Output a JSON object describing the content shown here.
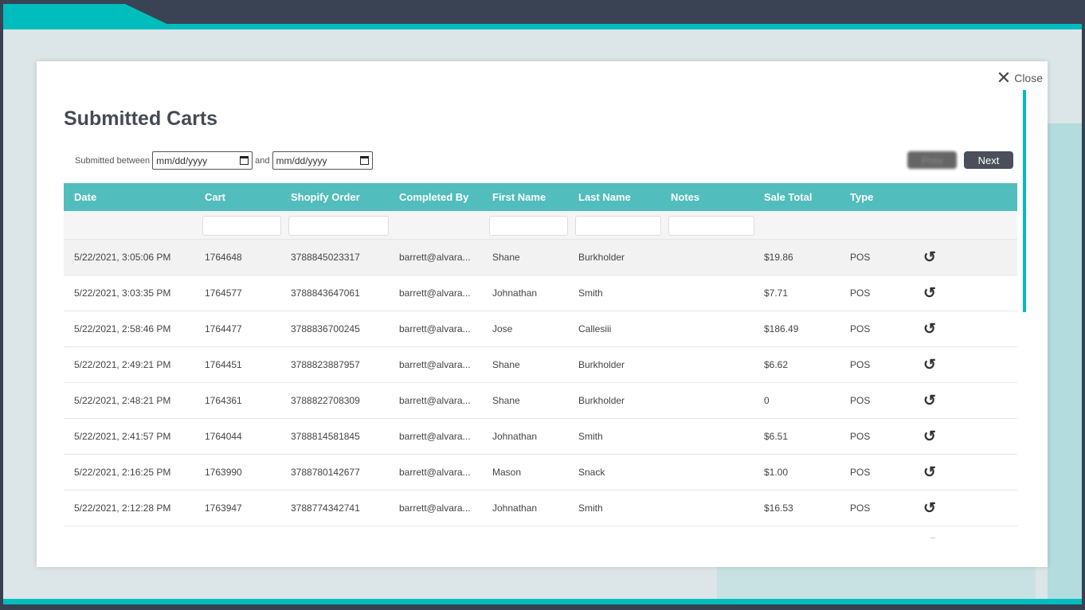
{
  "close_label": "Close",
  "title": "Submitted Carts",
  "filter": {
    "label": "Submitted between",
    "and": "and",
    "from_placeholder": "mm/dd/yyyy",
    "to_placeholder": "mm/dd/yyyy"
  },
  "pager": {
    "prev": "Prev",
    "next": "Next"
  },
  "colors": {
    "accent": "#00bdbd",
    "header": "#51bdbc",
    "button": "#4b4f5c"
  },
  "columns": [
    "Date",
    "Cart",
    "Shopify Order",
    "Completed By",
    "First Name",
    "Last Name",
    "Notes",
    "Sale Total",
    "Type"
  ],
  "rows": [
    [
      "5/22/2021, 3:05:06 PM",
      "1764648",
      "3788845023317",
      "barrett@alvara...",
      "Shane",
      "Burkholder",
      "",
      "$19.86",
      "POS"
    ],
    [
      "5/22/2021, 3:03:35 PM",
      "1764577",
      "3788843647061",
      "barrett@alvara...",
      "Johnathan",
      "Smith",
      "",
      "$7.71",
      "POS"
    ],
    [
      "5/22/2021, 2:58:46 PM",
      "1764477",
      "3788836700245",
      "barrett@alvara...",
      "Jose",
      "Callesiii",
      "",
      "$186.49",
      "POS"
    ],
    [
      "5/22/2021, 2:49:21 PM",
      "1764451",
      "3788823887957",
      "barrett@alvara...",
      "Shane",
      "Burkholder",
      "",
      "$6.62",
      "POS"
    ],
    [
      "5/22/2021, 2:48:21 PM",
      "1764361",
      "3788822708309",
      "barrett@alvara...",
      "Shane",
      "Burkholder",
      "",
      "0",
      "POS"
    ],
    [
      "5/22/2021, 2:41:57 PM",
      "1764044",
      "3788814581845",
      "barrett@alvara...",
      "Johnathan",
      "Smith",
      "",
      "$6.51",
      "POS"
    ],
    [
      "5/22/2021, 2:16:25 PM",
      "1763990",
      "3788780142677",
      "barrett@alvara...",
      "Mason",
      "Snack",
      "",
      "$1.00",
      "POS"
    ],
    [
      "5/22/2021, 2:12:28 PM",
      "1763947",
      "3788774342741",
      "barrett@alvara...",
      "Johnathan",
      "Smith",
      "",
      "$16.53",
      "POS"
    ],
    [
      "",
      "",
      "",
      "",
      "",
      "",
      "",
      "",
      ""
    ]
  ],
  "row_action_icon": "undo-icon"
}
